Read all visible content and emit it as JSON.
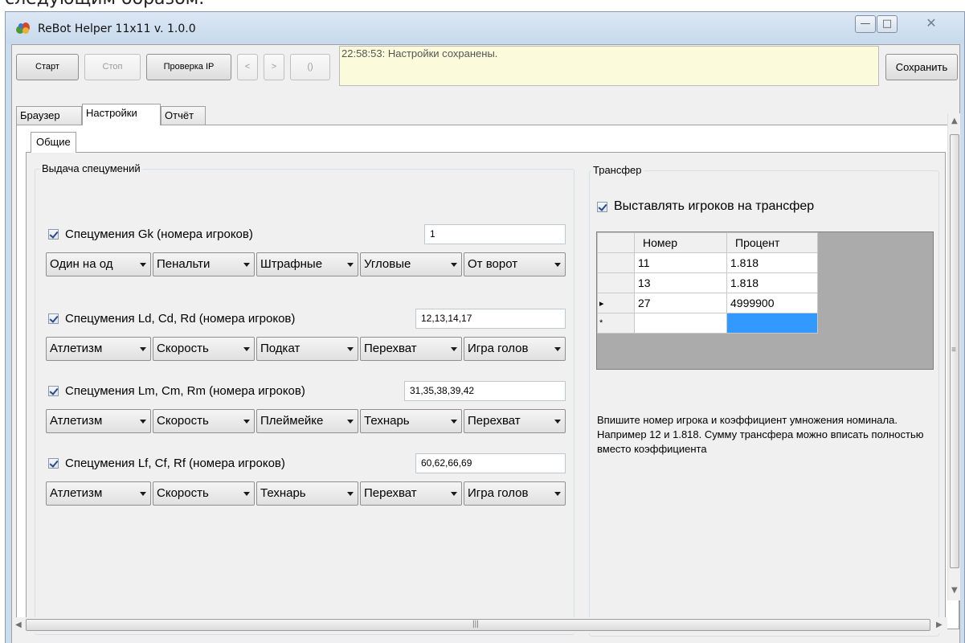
{
  "background_caption": "следующим образом.",
  "window": {
    "title": "ReBot Helper 11x11 v. 1.0.0",
    "minimize_glyph": "—",
    "maximize_glyph": "□",
    "close_glyph": "✕"
  },
  "toolbar": {
    "start": "Старт",
    "stop": "Стоп",
    "check_ip": "Проверка IP",
    "prev": "<",
    "next": ">",
    "paren": "()",
    "save": "Сохранить"
  },
  "status": {
    "message": "22:58:53: Настройки сохранены."
  },
  "tabs": [
    "Браузер",
    "Настройки",
    "Отчёт"
  ],
  "active_tab": "Настройки",
  "subtabs": [
    "Общие"
  ],
  "special_skills": {
    "title": "Выдача спецумений",
    "rows": [
      {
        "label": "Спецумения Gk (номера игроков)",
        "checked": true,
        "players": "1",
        "combos": [
          "Один на од",
          "Пенальти",
          "Штрафные",
          "Угловые",
          "От ворот"
        ]
      },
      {
        "label": "Спецумения Ld, Cd, Rd (номера игроков)",
        "checked": true,
        "players": "12,13,14,17",
        "combos": [
          "Атлетизм",
          "Скорость",
          "Подкат",
          "Перехват",
          "Игра голов"
        ]
      },
      {
        "label": "Спецумения Lm, Cm, Rm (номера игроков)",
        "checked": true,
        "players": "31,35,38,39,42",
        "combos": [
          "Атлетизм",
          "Скорость",
          "Плеймейке",
          "Технарь",
          "Перехват"
        ]
      },
      {
        "label": "Спецумения Lf, Cf, Rf (номера игроков)",
        "checked": true,
        "players": "60,62,66,69",
        "combos": [
          "Атлетизм",
          "Скорость",
          "Технарь",
          "Перехват",
          "Игра голов"
        ]
      }
    ]
  },
  "transfer": {
    "title": "Трансфер",
    "checkbox_label": "Выставлять игроков на трансфер",
    "checked": true,
    "grid": {
      "columns": [
        "Номер",
        "Процент"
      ],
      "rows": [
        {
          "marker": "",
          "number": "11",
          "percent": "1.818"
        },
        {
          "marker": "",
          "number": "13",
          "percent": "1.818"
        },
        {
          "marker": "▸",
          "number": "27",
          "percent": "4999900"
        }
      ],
      "new_row_marker": "*"
    },
    "hint": "Впишите номер игрока и коэффициент умножения номинала. Например 12 и 1.818. Сумму трансфера можно вписать полностью вместо коэффициента"
  },
  "scrollbars": {
    "vertical_grip": "≡",
    "horizontal_grip": "|||"
  }
}
